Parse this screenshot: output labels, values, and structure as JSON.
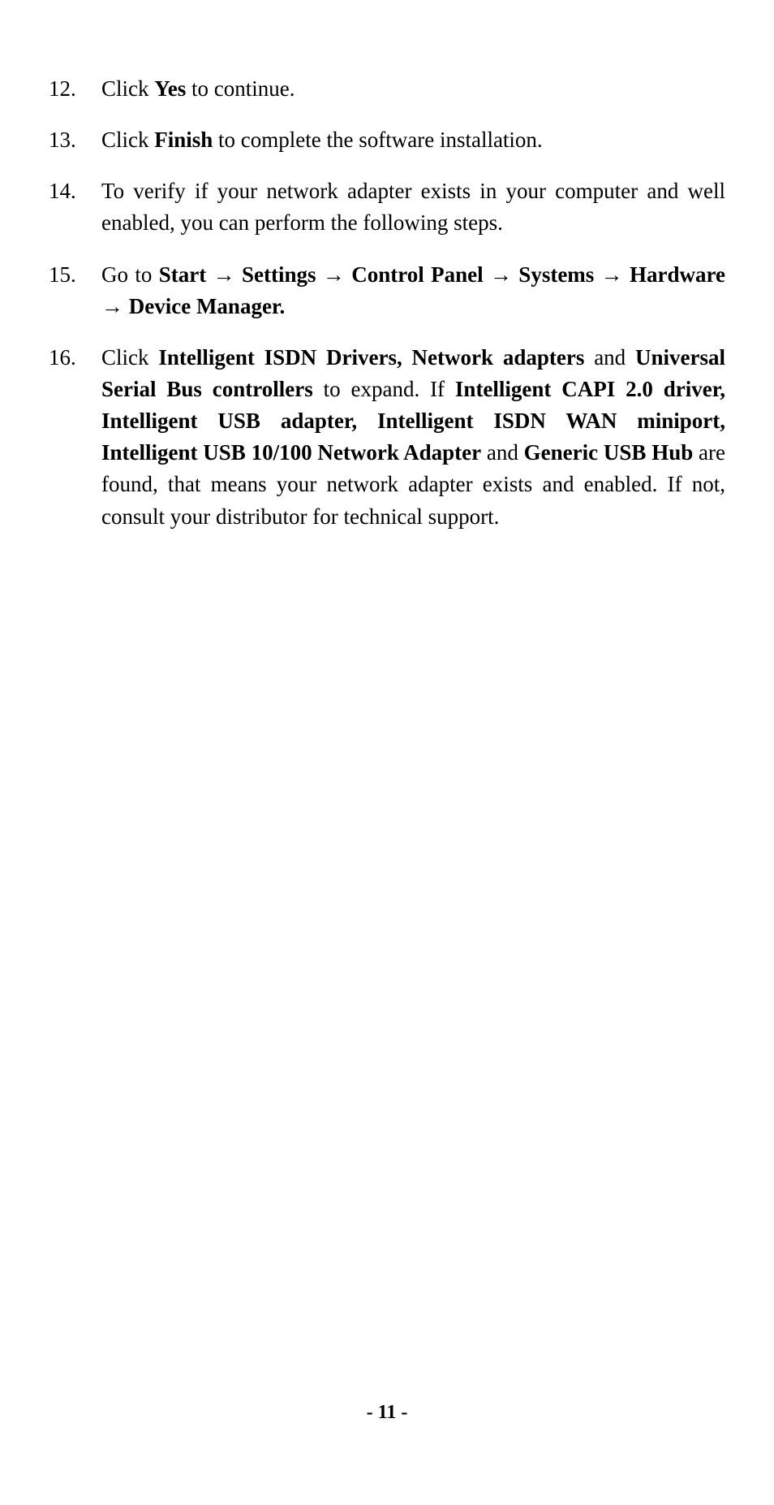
{
  "items": [
    {
      "number": "12.",
      "parts": [
        {
          "text": "Click ",
          "bold": false
        },
        {
          "text": "Yes",
          "bold": true
        },
        {
          "text": " to continue.",
          "bold": false
        }
      ]
    },
    {
      "number": "13.",
      "parts": [
        {
          "text": "Click ",
          "bold": false
        },
        {
          "text": "Finish",
          "bold": true
        },
        {
          "text": " to complete the software installation.",
          "bold": false
        }
      ]
    },
    {
      "number": "14.",
      "parts": [
        {
          "text": "To verify if your network adapter exists in your computer and well enabled, you can perform the following steps.",
          "bold": false
        }
      ]
    },
    {
      "number": "15.",
      "parts": [
        {
          "text": "Go to ",
          "bold": false
        },
        {
          "text": "Start ",
          "bold": true
        },
        {
          "text": "→",
          "bold": true,
          "arrow": true
        },
        {
          "text": " Settings ",
          "bold": true
        },
        {
          "text": "→",
          "bold": true,
          "arrow": true
        },
        {
          "text": " Control Panel ",
          "bold": true
        },
        {
          "text": "→",
          "bold": true,
          "arrow": true
        },
        {
          "text": " Systems ",
          "bold": true
        },
        {
          "text": "→",
          "bold": true,
          "arrow": true
        },
        {
          "text": " Hardware ",
          "bold": true
        },
        {
          "text": "→",
          "bold": true,
          "arrow": true
        },
        {
          "text": " Device Manager.",
          "bold": true
        }
      ]
    },
    {
      "number": "16.",
      "parts": [
        {
          "text": "Click ",
          "bold": false
        },
        {
          "text": "Intelligent ISDN Drivers, Network adapters",
          "bold": true
        },
        {
          "text": " and ",
          "bold": false
        },
        {
          "text": "Universal Serial Bus controllers",
          "bold": true
        },
        {
          "text": " to expand. If ",
          "bold": false
        },
        {
          "text": "Intelligent CAPI 2.0 driver, Intelligent USB adapter, Intelligent ISDN WAN miniport, Intelligent USB 10/100 Network Adapter",
          "bold": true
        },
        {
          "text": " and ",
          "bold": false
        },
        {
          "text": "Generic USB Hub",
          "bold": true
        },
        {
          "text": " are found, that means your network adapter exists and enabled.  If not, consult your distributor for technical support.",
          "bold": false
        }
      ]
    }
  ],
  "pageNumber": "- 11 -"
}
